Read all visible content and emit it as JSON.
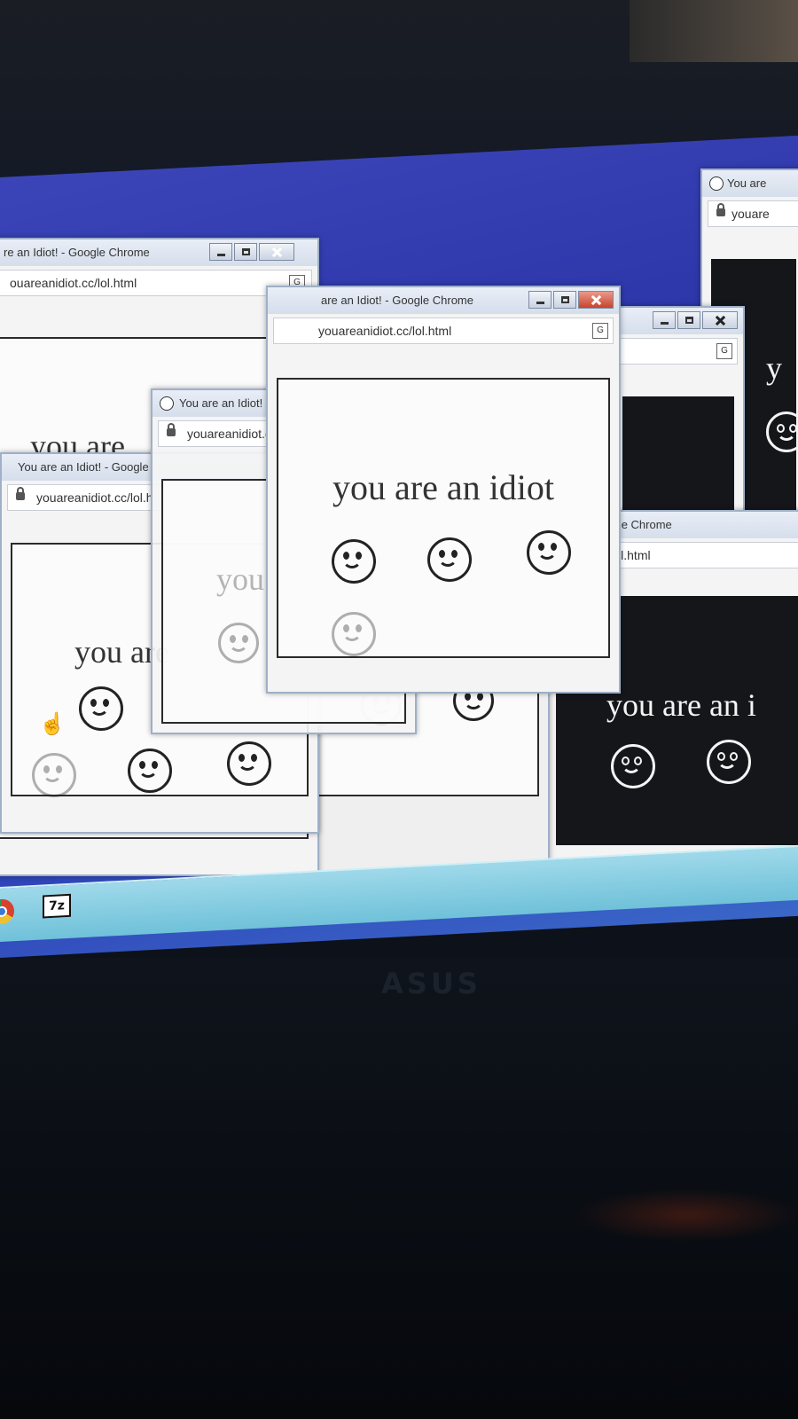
{
  "window": {
    "title": "You are an Idiot! - Google Chrome",
    "title_short": "You are an Idiot! - Google",
    "title_partial": "are an Idiot! - Google Chrome",
    "title_left_crop": "re an Idiot! - Google Chrome",
    "title_right_crop": "You are",
    "title_idiot_crop": "idiot! - Google Chrome",
    "url": "youareanidiot.cc/lol.html",
    "url_left_crop": "ouareanidiot.cc/lol.html",
    "url_short": "youareanidiot.cc/lol.h",
    "url_partial": "youareanidiot.cc/lol.html",
    "url_cut": "youare",
    "url_cropped_right": "nidiot.cc/lol.html"
  },
  "page": {
    "message": "you are an idiot",
    "message_partial": "you are",
    "message_cut": "you are an i",
    "letter_y": "y"
  },
  "taskbar": {
    "zip_label": "7z"
  },
  "bezel": {
    "brand": "ASUS"
  },
  "colors": {
    "desktop": "#2c3bb5",
    "taskbar": "#8fd1e5",
    "window_frame": "#9fb0c8",
    "close_button": "#c9432b"
  }
}
